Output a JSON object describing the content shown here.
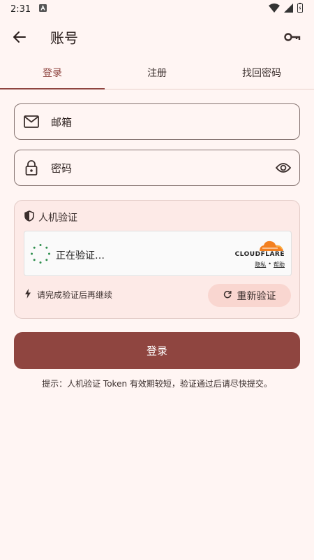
{
  "status_bar": {
    "time": "2:31",
    "notification_icon": "a-icon",
    "icons": [
      "wifi-icon",
      "signal-icon",
      "battery-icon"
    ]
  },
  "app_bar": {
    "title": "账号",
    "back_icon": "arrow-left-icon",
    "action_icon": "key-icon"
  },
  "tabs": [
    {
      "label": "登录",
      "active": true
    },
    {
      "label": "注册",
      "active": false
    },
    {
      "label": "找回密码",
      "active": false
    }
  ],
  "form": {
    "email": {
      "placeholder": "邮箱",
      "icon": "mail-icon"
    },
    "password": {
      "placeholder": "密码",
      "icon": "lock-icon",
      "toggle_icon": "eye-icon"
    }
  },
  "captcha": {
    "title": "人机验证",
    "title_icon": "shield-icon",
    "widget": {
      "status": "正在验证…",
      "brand": "CLOUDFLARE",
      "privacy_link": "隐私",
      "separator": "•",
      "help_link": "帮助"
    },
    "hint": "请完成验证后再继续",
    "hint_icon": "bolt-icon",
    "retry_label": "重新验证",
    "retry_icon": "refresh-icon"
  },
  "login_button": "登录",
  "tip": "提示：人机验证 Token 有效期较短，验证通过后请尽快提交。",
  "colors": {
    "primary": "#8f4540",
    "background": "#fff5f3",
    "card": "#fdeae7",
    "tonal_button": "#f9d6d0",
    "cloudflare_orange": "#f38020"
  }
}
